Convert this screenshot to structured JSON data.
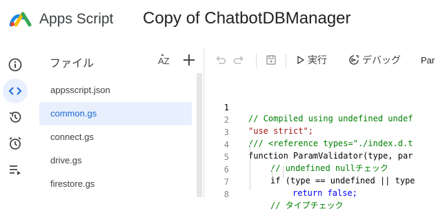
{
  "header": {
    "app_name": "Apps Script",
    "project_name": "Copy of ChatbotDBManager"
  },
  "rail": {
    "items": [
      {
        "icon": "info-icon"
      },
      {
        "icon": "code-icon",
        "active": true
      },
      {
        "icon": "history-icon"
      },
      {
        "icon": "alarm-icon"
      },
      {
        "icon": "executions-icon"
      }
    ]
  },
  "files": {
    "title": "ファイル",
    "sort_label": "AZ",
    "items": [
      {
        "name": "appsscript.json"
      },
      {
        "name": "common.gs",
        "active": true
      },
      {
        "name": "connect.gs"
      },
      {
        "name": "drive.gs"
      },
      {
        "name": "firestore.gs"
      }
    ]
  },
  "toolbar": {
    "run_label": "実行",
    "debug_label": "デバッグ",
    "function_select": "Par"
  },
  "editor": {
    "lines": [
      {
        "n": "1",
        "code": "// Compiled using undefined undef"
      },
      {
        "n": "2",
        "code": "\"use strict\";"
      },
      {
        "n": "3",
        "code": "/// <reference types=\"./index.d.t"
      },
      {
        "n": "4",
        "code": "function ParamValidator(type, par"
      },
      {
        "n": "5",
        "code": "// undefined nullチェック"
      },
      {
        "n": "6",
        "code": "if (type == undefined || type"
      },
      {
        "n": "7",
        "code": "return false;"
      },
      {
        "n": "8",
        "code": "// タイプチェック"
      }
    ]
  },
  "colors": {
    "accent": "#1967d2",
    "active_bg": "#e8f0fe",
    "comment": "#008000",
    "string": "#a31515",
    "keyword": "#0000ff"
  }
}
